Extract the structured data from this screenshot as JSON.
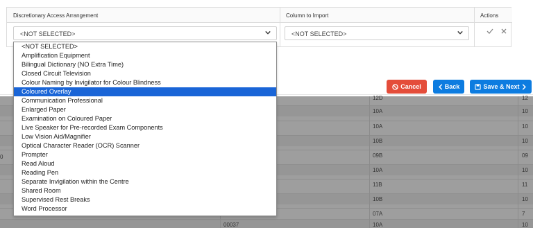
{
  "mapping": {
    "headers": {
      "arrangement": "Discretionary Access Arrangement",
      "column": "Column to Import",
      "actions": "Actions"
    },
    "arrangement_select_value": "<NOT SELECTED>",
    "column_select_value": "<NOT SELECTED>"
  },
  "dropdown": {
    "options": [
      "<NOT SELECTED>",
      "Amplification Equipment",
      "Bilingual Dictionary (NO Extra Time)",
      "Closed Circuit Television",
      "Colour Naming by Invigilator for Colour Blindness",
      "Coloured Overlay",
      "Communication Professional",
      "Enlarged Paper",
      "Examination on Coloured Paper",
      "Live Speaker for Pre-recorded Exam Components",
      "Low Vision Aid/Magnifier",
      "Optical Character Reader (OCR) Scanner",
      "Prompter",
      "Read Aloud",
      "Reading Pen",
      "Separate Invigilation within the Centre",
      "Shared Room",
      "Supervised Rest Breaks",
      "Word Processor"
    ],
    "highlighted_index": 5
  },
  "buttons": {
    "cancel": "Cancel",
    "back": "Back",
    "save_next": "Save & Next"
  },
  "background_table": {
    "rows": [
      {
        "c1": "",
        "c2": "12D",
        "c3": "12"
      },
      {
        "c1": "",
        "c2": "10A",
        "c3": "10"
      },
      {
        "c1": "",
        "c2": "10A",
        "c3": "10"
      },
      {
        "c1": "",
        "c2": "10B",
        "c3": "10"
      },
      {
        "c1": "",
        "c2": "09B",
        "c3": "09"
      },
      {
        "c1": "",
        "c2": "10A",
        "c3": "10"
      },
      {
        "c1": "",
        "c2": "11B",
        "c3": "11"
      },
      {
        "c1": "",
        "c2": "10B",
        "c3": "10"
      },
      {
        "c1": "",
        "c2": "07A",
        "c3": "7"
      },
      {
        "c1": "00037",
        "c2": "10A",
        "c3": "10"
      }
    ],
    "left_stub": "0"
  },
  "colors": {
    "cancel": "#e44d3a",
    "primary": "#0d7ce0",
    "highlight": "#1a65d7"
  }
}
